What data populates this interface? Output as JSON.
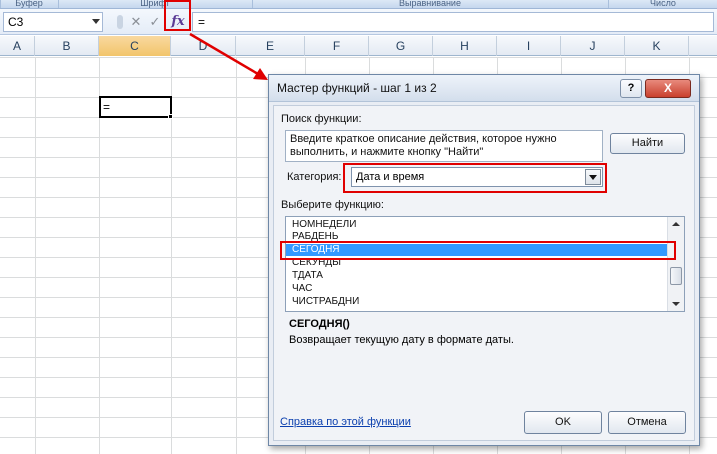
{
  "ribbon": {
    "groups": [
      "Буфер обмена",
      "Шрифт",
      "Выравнивание",
      "Число"
    ]
  },
  "formula_bar": {
    "name_box": "C3",
    "cancel_glyph": "✕",
    "enter_glyph": "✓",
    "fx_label": "fx",
    "formula": "="
  },
  "grid": {
    "columns": [
      "A",
      "B",
      "C",
      "D",
      "E",
      "F",
      "G",
      "H",
      "I",
      "J",
      "K"
    ],
    "active_column": "C",
    "active_cell_value": "="
  },
  "dialog": {
    "title": "Мастер функций - шаг 1 из 2",
    "help_glyph": "?",
    "close_glyph": "X",
    "search_label": "Поиск функции:",
    "search_text_line1": "Введите краткое описание действия, которое нужно",
    "search_text_line2": "выполнить, и нажмите кнопку \"Найти\"",
    "find_button": "Найти",
    "category_label": "Категория:",
    "category_value": "Дата и время",
    "select_label": "Выберите функцию:",
    "functions": [
      {
        "name": "НОМНЕДЕЛИ",
        "selected": false
      },
      {
        "name": "РАБДЕНЬ",
        "selected": false
      },
      {
        "name": "СЕГОДНЯ",
        "selected": true
      },
      {
        "name": "СЕКУНДЫ",
        "selected": false
      },
      {
        "name": "ТДАТА",
        "selected": false
      },
      {
        "name": "ЧАС",
        "selected": false
      },
      {
        "name": "ЧИСТРАБДНИ",
        "selected": false
      }
    ],
    "func_signature": "СЕГОДНЯ()",
    "func_description": "Возвращает текущую дату в формате даты.",
    "help_link": "Справка по этой функции",
    "ok_button": "OK",
    "cancel_button": "Отмена"
  },
  "colors": {
    "highlight_red": "#e00000",
    "selection_blue": "#3399ff",
    "link_blue": "#0b3fae"
  }
}
